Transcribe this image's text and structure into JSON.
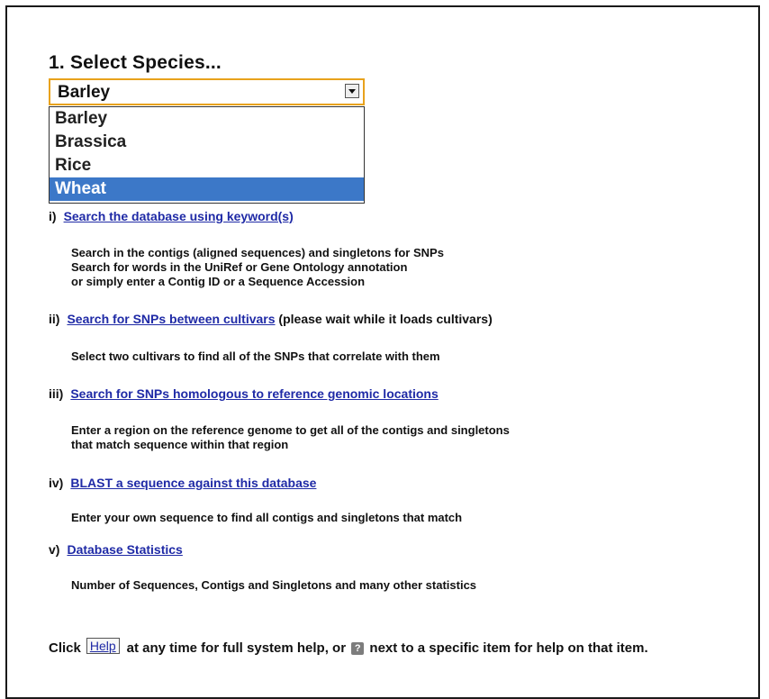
{
  "title": "1. Select Species...",
  "select": {
    "value": "Barley",
    "options": [
      "Barley",
      "Brassica",
      "Rice",
      "Wheat"
    ],
    "highlighted": "Wheat"
  },
  "sections": [
    {
      "num": "i)",
      "link": "Search the database using keyword(s)",
      "suffix": "",
      "desc": [
        "Search in the contigs (aligned sequences) and singletons for SNPs",
        "Search for words in the UniRef or Gene Ontology annotation",
        "or simply enter a Contig ID or a Sequence Accession"
      ]
    },
    {
      "num": "ii)",
      "link": "Search for SNPs between cultivars",
      "suffix": " (please wait while it loads cultivars)",
      "desc": [
        "Select two cultivars to find all of the SNPs that correlate with them"
      ]
    },
    {
      "num": "iii)",
      "link": "Search for SNPs homologous to reference genomic locations",
      "suffix": "",
      "desc": [
        "Enter a region on the reference genome to get all of the contigs and singletons",
        "that match sequence within that region"
      ]
    },
    {
      "num": "iv)",
      "link": "BLAST a sequence against this database",
      "suffix": "",
      "desc": [
        "Enter your own sequence to find all contigs and singletons that match"
      ]
    },
    {
      "num": "v)",
      "link": "Database Statistics",
      "suffix": "",
      "desc": [
        "Number of Sequences, Contigs and Singletons and many other statistics"
      ]
    }
  ],
  "footer": {
    "prefix": "Click",
    "help_label": "Help",
    "middle": "at any time for full system help, or",
    "help_icon": "question-mark-icon",
    "suffix": "next to a specific item for help on that item."
  },
  "colors": {
    "link": "#1f2aa6",
    "select_border": "#e8a21c",
    "highlight": "#3c78c8"
  }
}
